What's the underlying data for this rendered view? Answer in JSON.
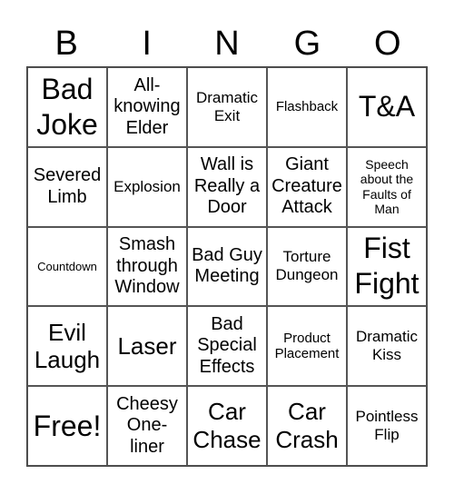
{
  "header": [
    "B",
    "I",
    "N",
    "G",
    "O"
  ],
  "cells": [
    {
      "text": "Bad Joke",
      "size": "xl"
    },
    {
      "text": "All-knowing Elder",
      "size": "m"
    },
    {
      "text": "Dramatic Exit",
      "size": "s"
    },
    {
      "text": "Flashback",
      "size": "xs"
    },
    {
      "text": "T&A",
      "size": "xl"
    },
    {
      "text": "Severed Limb",
      "size": "m"
    },
    {
      "text": "Explosion",
      "size": "s"
    },
    {
      "text": "Wall is Really a Door",
      "size": "m"
    },
    {
      "text": "Giant Creature Attack",
      "size": "m"
    },
    {
      "text": "Speech about the Faults of Man",
      "size": "xxs"
    },
    {
      "text": "Countdown",
      "size": "t"
    },
    {
      "text": "Smash through Window",
      "size": "m"
    },
    {
      "text": "Bad Guy Meeting",
      "size": "m"
    },
    {
      "text": "Torture Dungeon",
      "size": "s"
    },
    {
      "text": "Fist Fight",
      "size": "xl"
    },
    {
      "text": "Evil Laugh",
      "size": "l"
    },
    {
      "text": "Laser",
      "size": "l"
    },
    {
      "text": "Bad Special Effects",
      "size": "m"
    },
    {
      "text": "Product Placement",
      "size": "xs"
    },
    {
      "text": "Dramatic Kiss",
      "size": "s"
    },
    {
      "text": "Free!",
      "size": "xl"
    },
    {
      "text": "Cheesy One-liner",
      "size": "m"
    },
    {
      "text": "Car Chase",
      "size": "l"
    },
    {
      "text": "Car Crash",
      "size": "l"
    },
    {
      "text": "Pointless Flip",
      "size": "s"
    }
  ]
}
